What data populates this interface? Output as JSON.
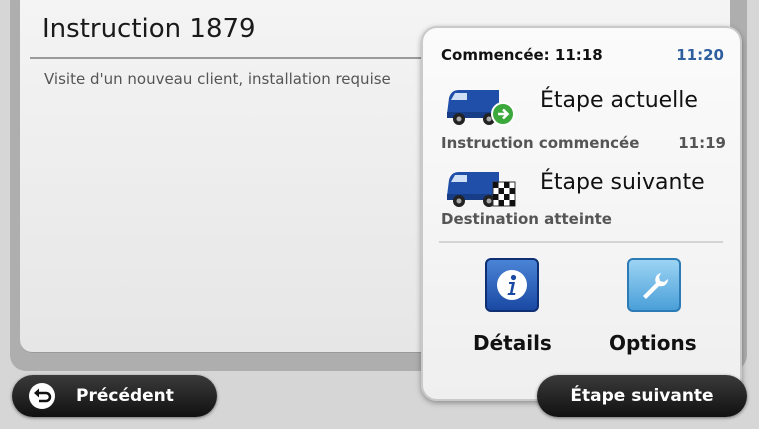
{
  "instruction": {
    "title": "Instruction 1879",
    "description": "Visite d'un nouveau client, installation requise"
  },
  "panel": {
    "started_label": "Commencée: 11:18",
    "clock": "11:20",
    "current_step": {
      "title": "Étape actuelle",
      "status": "Instruction commencée",
      "time": "11:19"
    },
    "next_step": {
      "title": "Étape suivante",
      "status": "Destination atteinte"
    },
    "actions": [
      {
        "label": "Détails",
        "icon": "info-icon"
      },
      {
        "label": "Options",
        "icon": "wrench-icon"
      }
    ]
  },
  "nav": {
    "back_label": "Précédent",
    "next_label": "Étape suivante"
  },
  "colors": {
    "accent_blue": "#2e5f9e",
    "van_blue": "#1f4fa8",
    "start_green": "#3aa83a",
    "pill_dark": "#1a1a1a"
  }
}
